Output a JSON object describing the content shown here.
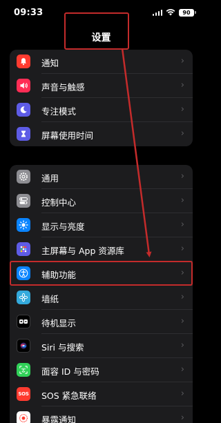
{
  "status_bar": {
    "time": "09:33",
    "battery": "90"
  },
  "header": {
    "title": "设置"
  },
  "groups": [
    {
      "items": [
        {
          "label": "通知",
          "icon": "bell-icon",
          "color": "#ff3b30"
        },
        {
          "label": "声音与触感",
          "icon": "speaker-icon",
          "color": "#ff2d55"
        },
        {
          "label": "专注模式",
          "icon": "moon-icon",
          "color": "#5e5ce6"
        },
        {
          "label": "屏幕使用时间",
          "icon": "hourglass-icon",
          "color": "#5e5ce6"
        }
      ]
    },
    {
      "items": [
        {
          "label": "通用",
          "icon": "gear-icon",
          "color": "#8e8e93"
        },
        {
          "label": "控制中心",
          "icon": "toggles-icon",
          "color": "#8e8e93"
        },
        {
          "label": "显示与亮度",
          "icon": "sun-icon",
          "color": "#0a84ff"
        },
        {
          "label": "主屏幕与 App 资源库",
          "icon": "home-grid-icon",
          "color": "#5e5ce6"
        },
        {
          "label": "辅助功能",
          "icon": "accessibility-icon",
          "color": "#0a84ff"
        },
        {
          "label": "墙纸",
          "icon": "flower-icon",
          "color": "#34aadc"
        },
        {
          "label": "待机显示",
          "icon": "standby-icon",
          "color": "#1c1c1e"
        },
        {
          "label": "Siri 与搜索",
          "icon": "siri-icon",
          "color": "#1c1c1e"
        },
        {
          "label": "面容 ID 与密码",
          "icon": "face-id-icon",
          "color": "#30d158"
        },
        {
          "label": "SOS 紧急联络",
          "icon": "sos-icon",
          "color": "#ff3b30"
        },
        {
          "label": "暴露通知",
          "icon": "exposure-icon",
          "color": "#ffffff"
        }
      ]
    }
  ],
  "annotation_color": "#c42b2b"
}
